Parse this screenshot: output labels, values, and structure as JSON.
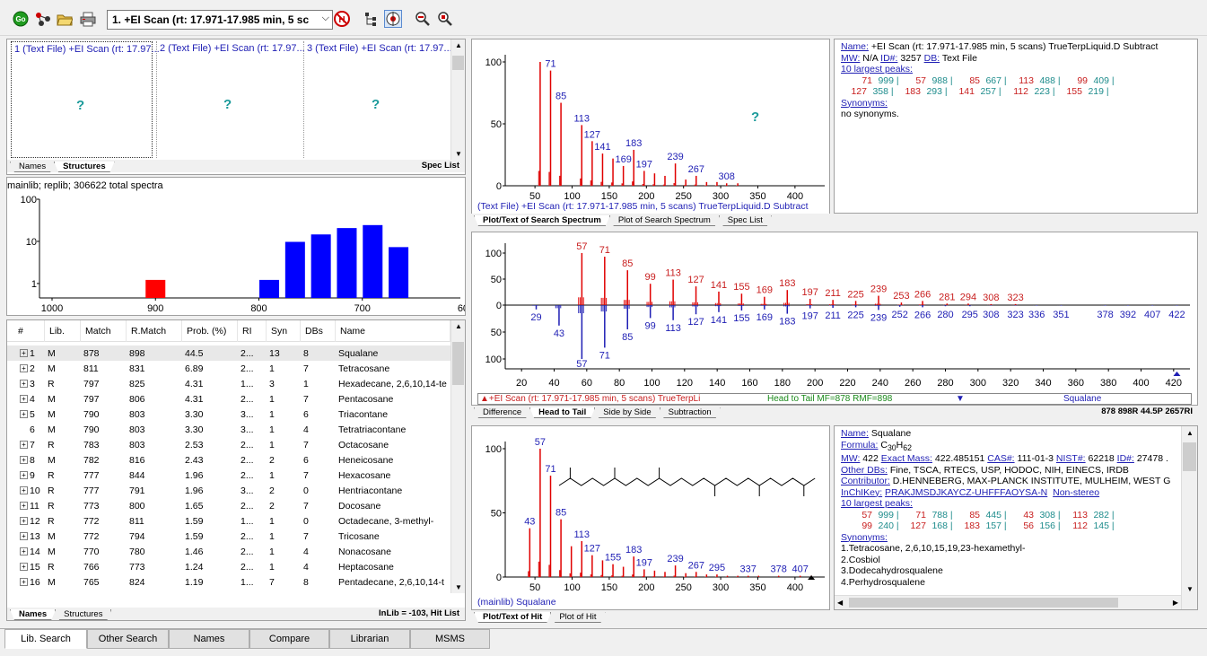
{
  "toolbar": {
    "scan_dropdown": "1. +EI Scan (rt: 17.971-17.985 min, 5 sc",
    "go_label": "Go"
  },
  "structures": {
    "cells": [
      {
        "label": "1 (Text File) +EI Scan (rt: 17.97...",
        "mark": "?"
      },
      {
        "label": "2 (Text File) +EI Scan (rt: 17.97...",
        "mark": "?"
      },
      {
        "label": "3 (Text File) +EI Scan (rt: 17.97...",
        "mark": "?"
      }
    ],
    "tabs": [
      "Names",
      "Structures"
    ],
    "right_label": "Spec List"
  },
  "histogram": {
    "header": "mainlib; replib;  306622 total spectra",
    "ylabels": [
      "100",
      "10",
      "1"
    ],
    "xlabels": [
      "1000",
      "900",
      "800",
      "700",
      "600"
    ],
    "bars": [
      {
        "match": 900,
        "value": 1,
        "color": "#ff0000"
      },
      {
        "match": 790,
        "value": 1,
        "color": "#0000ff"
      },
      {
        "match": 765,
        "value": 8,
        "color": "#0000ff"
      },
      {
        "match": 740,
        "value": 12,
        "color": "#0000ff"
      },
      {
        "match": 715,
        "value": 17,
        "color": "#0000ff"
      },
      {
        "match": 690,
        "value": 20,
        "color": "#0000ff"
      },
      {
        "match": 665,
        "value": 6,
        "color": "#0000ff"
      }
    ]
  },
  "hitlist": {
    "columns": [
      "#",
      "Lib.",
      "Match",
      "R.Match",
      "Prob. (%)",
      "RI",
      "Syn",
      "DBs",
      "Name"
    ],
    "rows": [
      [
        "1",
        "M",
        "878",
        "898",
        "44.5",
        "2...",
        "13",
        "8",
        "Squalane"
      ],
      [
        "2",
        "M",
        "811",
        "831",
        "6.89",
        "2...",
        "1",
        "7",
        "Tetracosane"
      ],
      [
        "3",
        "R",
        "797",
        "825",
        "4.31",
        "1...",
        "3",
        "1",
        "Hexadecane, 2,6,10,14-te"
      ],
      [
        "4",
        "M",
        "797",
        "806",
        "4.31",
        "2...",
        "1",
        "7",
        "Pentacosane"
      ],
      [
        "5",
        "M",
        "790",
        "803",
        "3.30",
        "3...",
        "1",
        "6",
        "Triacontane"
      ],
      [
        "6",
        "M",
        "790",
        "803",
        "3.30",
        "3...",
        "1",
        "4",
        "Tetratriacontane"
      ],
      [
        "7",
        "R",
        "783",
        "803",
        "2.53",
        "2...",
        "1",
        "7",
        "Octacosane"
      ],
      [
        "8",
        "M",
        "782",
        "816",
        "2.43",
        "2...",
        "2",
        "6",
        "Heneicosane"
      ],
      [
        "9",
        "R",
        "777",
        "844",
        "1.96",
        "2...",
        "1",
        "7",
        "Hexacosane"
      ],
      [
        "10",
        "R",
        "777",
        "791",
        "1.96",
        "3...",
        "2",
        "0",
        "Hentriacontane"
      ],
      [
        "11",
        "R",
        "773",
        "800",
        "1.65",
        "2...",
        "2",
        "7",
        "Docosane"
      ],
      [
        "12",
        "R",
        "772",
        "811",
        "1.59",
        "1...",
        "1",
        "0",
        "Octadecane, 3-methyl-"
      ],
      [
        "13",
        "M",
        "772",
        "794",
        "1.59",
        "2...",
        "1",
        "7",
        "Tricosane"
      ],
      [
        "14",
        "M",
        "770",
        "780",
        "1.46",
        "2...",
        "1",
        "4",
        "Nonacosane"
      ],
      [
        "15",
        "R",
        "766",
        "773",
        "1.24",
        "2...",
        "1",
        "4",
        "Heptacosane"
      ],
      [
        "16",
        "M",
        "765",
        "824",
        "1.19",
        "1...",
        "7",
        "8",
        "Pentadecane, 2,6,10,14-t"
      ]
    ],
    "tabs": [
      "Names",
      "Structures"
    ],
    "right_label": "InLib = -103, Hit List"
  },
  "search_spectrum": {
    "footer": "(Text File) +EI Scan (rt: 17.971-17.985 min, 5 scans) TrueTerpLiquid.D  Subtract",
    "mark": "?",
    "ylabels": [
      "100",
      "50",
      "0"
    ],
    "xlabels": [
      "50",
      "100",
      "150",
      "200",
      "250",
      "300",
      "350",
      "400"
    ],
    "peaks": [
      {
        "mz": 57,
        "i": 100
      },
      {
        "mz": 71,
        "i": 93
      },
      {
        "mz": 85,
        "i": 67
      },
      {
        "mz": 113,
        "i": 49
      },
      {
        "mz": 127,
        "i": 36
      },
      {
        "mz": 141,
        "i": 26
      },
      {
        "mz": 155,
        "i": 22
      },
      {
        "mz": 169,
        "i": 16
      },
      {
        "mz": 183,
        "i": 29
      },
      {
        "mz": 197,
        "i": 12
      },
      {
        "mz": 211,
        "i": 10
      },
      {
        "mz": 225,
        "i": 8
      },
      {
        "mz": 239,
        "i": 18
      },
      {
        "mz": 253,
        "i": 5
      },
      {
        "mz": 267,
        "i": 8
      },
      {
        "mz": 281,
        "i": 3
      },
      {
        "mz": 295,
        "i": 3
      },
      {
        "mz": 308,
        "i": 2
      },
      {
        "mz": 323,
        "i": 2
      }
    ],
    "labels": [
      {
        "mz": 71,
        "text": "71"
      },
      {
        "mz": 85,
        "text": "85"
      },
      {
        "mz": 113,
        "text": "113"
      },
      {
        "mz": 127,
        "text": "127"
      },
      {
        "mz": 141,
        "text": "141"
      },
      {
        "mz": 169,
        "text": "169"
      },
      {
        "mz": 183,
        "text": "183"
      },
      {
        "mz": 197,
        "text": "197"
      },
      {
        "mz": 239,
        "text": "239"
      },
      {
        "mz": 267,
        "text": "267"
      },
      {
        "mz": 308,
        "text": "308"
      }
    ],
    "tabs": [
      "Plot/Text of Search Spectrum",
      "Plot of Search Spectrum",
      "Spec List"
    ]
  },
  "search_info": {
    "name_label": "Name:",
    "name_value": " +EI Scan (rt: 17.971-17.985 min, 5 scans) TrueTerpLiquid.D  Subtract",
    "mw_label": "MW:",
    "mw_value": "  N/A ",
    "id_label": "ID#:",
    "id_value": " 3257 ",
    "db_label": "DB:",
    "db_value": " Text File",
    "peaks_label": "10 largest peaks:",
    "peaks_row1": [
      {
        "mz": "71",
        "i": "999"
      },
      {
        "mz": "57",
        "i": "988"
      },
      {
        "mz": "85",
        "i": "667"
      },
      {
        "mz": "113",
        "i": "488"
      },
      {
        "mz": "99",
        "i": "409"
      }
    ],
    "peaks_row2": [
      {
        "mz": "127",
        "i": "358"
      },
      {
        "mz": "183",
        "i": "293"
      },
      {
        "mz": "141",
        "i": "257"
      },
      {
        "mz": "112",
        "i": "223"
      },
      {
        "mz": "155",
        "i": "219"
      }
    ],
    "syn_label": "Synonyms:",
    "syn_value": "no synonyms."
  },
  "head_to_tail": {
    "ylabels_top": [
      "100",
      "50",
      "0"
    ],
    "ylabels_bottom": [
      "50",
      "100"
    ],
    "xlabels": [
      "20",
      "40",
      "60",
      "80",
      "100",
      "120",
      "140",
      "160",
      "180",
      "200",
      "220",
      "240",
      "260",
      "280",
      "300",
      "320",
      "340",
      "360",
      "380",
      "400",
      "420"
    ],
    "top_labels": [
      "57",
      "71",
      "85",
      "99",
      "113",
      "127",
      "141",
      "155",
      "169",
      "183",
      "197",
      "211",
      "225",
      "239",
      "253",
      "266",
      "281",
      "294",
      "308",
      "323"
    ],
    "bottom_labels": [
      "29",
      "43",
      "57",
      "71",
      "85",
      "99",
      "113",
      "127",
      "141",
      "155",
      "169",
      "183",
      "197",
      "211",
      "225",
      "239",
      "252",
      "266",
      "280",
      "295",
      "308",
      "323",
      "336",
      "351",
      "378",
      "392",
      "407",
      "422"
    ],
    "status_left": "+EI Scan (rt: 17.971-17.985 min, 5 scans) TrueTerpLi",
    "status_mid": "Head to Tail MF=878 RMF=898",
    "status_right": "Squalane",
    "tabs": [
      "Difference",
      "Head to Tail",
      "Side by Side",
      "Subtraction"
    ],
    "right_label": "878 898R 44.5P 2657RI"
  },
  "hit_spectrum": {
    "footer": "(mainlib) Squalane",
    "ylabels": [
      "100",
      "50",
      "0"
    ],
    "xlabels": [
      "50",
      "100",
      "150",
      "200",
      "250",
      "300",
      "350",
      "400"
    ],
    "peaks": [
      {
        "mz": 43,
        "i": 38
      },
      {
        "mz": 57,
        "i": 100
      },
      {
        "mz": 71,
        "i": 79
      },
      {
        "mz": 85,
        "i": 45
      },
      {
        "mz": 99,
        "i": 24
      },
      {
        "mz": 113,
        "i": 28
      },
      {
        "mz": 127,
        "i": 17
      },
      {
        "mz": 141,
        "i": 13
      },
      {
        "mz": 155,
        "i": 10
      },
      {
        "mz": 169,
        "i": 8
      },
      {
        "mz": 183,
        "i": 16
      },
      {
        "mz": 197,
        "i": 6
      },
      {
        "mz": 211,
        "i": 5
      },
      {
        "mz": 225,
        "i": 4
      },
      {
        "mz": 239,
        "i": 9
      },
      {
        "mz": 253,
        "i": 3
      },
      {
        "mz": 267,
        "i": 4
      },
      {
        "mz": 281,
        "i": 2
      },
      {
        "mz": 295,
        "i": 2
      },
      {
        "mz": 309,
        "i": 1
      },
      {
        "mz": 323,
        "i": 1
      },
      {
        "mz": 337,
        "i": 1
      },
      {
        "mz": 351,
        "i": 1
      },
      {
        "mz": 378,
        "i": 1
      },
      {
        "mz": 407,
        "i": 1
      },
      {
        "mz": 422,
        "i": 1
      }
    ],
    "labels": [
      {
        "mz": 43,
        "text": "43"
      },
      {
        "mz": 57,
        "text": "57"
      },
      {
        "mz": 71,
        "text": "71"
      },
      {
        "mz": 85,
        "text": "85"
      },
      {
        "mz": 113,
        "text": "113"
      },
      {
        "mz": 127,
        "text": "127"
      },
      {
        "mz": 155,
        "text": "155"
      },
      {
        "mz": 183,
        "text": "183"
      },
      {
        "mz": 197,
        "text": "197"
      },
      {
        "mz": 239,
        "text": "239"
      },
      {
        "mz": 267,
        "text": "267"
      },
      {
        "mz": 295,
        "text": "295"
      },
      {
        "mz": 337,
        "text": "337"
      },
      {
        "mz": 378,
        "text": "378"
      },
      {
        "mz": 407,
        "text": "407"
      }
    ],
    "tabs": [
      "Plot/Text of Hit",
      "Plot of Hit"
    ]
  },
  "hit_info": {
    "name_label": "Name:",
    "name_value": " Squalane",
    "formula_label": "Formula:",
    "formula_c": " C",
    "formula_c_sub": "30",
    "formula_h": "H",
    "formula_h_sub": "62",
    "mw_label": "MW:",
    "mw_value": " 422 ",
    "exact_label": "Exact Mass:",
    "exact_value": " 422.485151 ",
    "cas_label": "CAS#:",
    "cas_value": " 111-01-3 ",
    "nist_label": "NIST#:",
    "nist_value": " 62218 ",
    "id_label": "ID#:",
    "id_value": " 27478 .",
    "otherdb_label": "Other DBs:",
    "otherdb_value": " Fine, TSCA, RTECS, USP, HODOC, NIH, EINECS, IRDB",
    "contrib_label": "Contributor:",
    "contrib_value": " D.HENNEBERG, MAX-PLANCK INSTITUTE, MULHEIM, WEST G",
    "inchi_label": "InChIKey:",
    "inchi_value": "PRAKJMSDJKAYCZ-UHFFFAOYSA-N",
    "inchi_extra": "Non-stereo",
    "peaks_label": "10 largest peaks:",
    "peaks_row1": [
      {
        "mz": "57",
        "i": "999"
      },
      {
        "mz": "71",
        "i": "788"
      },
      {
        "mz": "85",
        "i": "445"
      },
      {
        "mz": "43",
        "i": "308"
      },
      {
        "mz": "113",
        "i": "282"
      }
    ],
    "peaks_row2": [
      {
        "mz": "99",
        "i": "240"
      },
      {
        "mz": "127",
        "i": "168"
      },
      {
        "mz": "183",
        "i": "157"
      },
      {
        "mz": "56",
        "i": "156"
      },
      {
        "mz": "112",
        "i": "145"
      }
    ],
    "syn_label": "Synonyms:",
    "synonyms": [
      "1.Tetracosane, 2,6,10,15,19,23-hexamethyl-",
      "2.Cosbiol",
      "3.Dodecahydrosqualene",
      "4.Perhydrosqualene"
    ]
  },
  "bottom_tabs": [
    "Lib. Search",
    "Other Search",
    "Names",
    "Compare",
    "Librarian",
    "MSMS"
  ]
}
